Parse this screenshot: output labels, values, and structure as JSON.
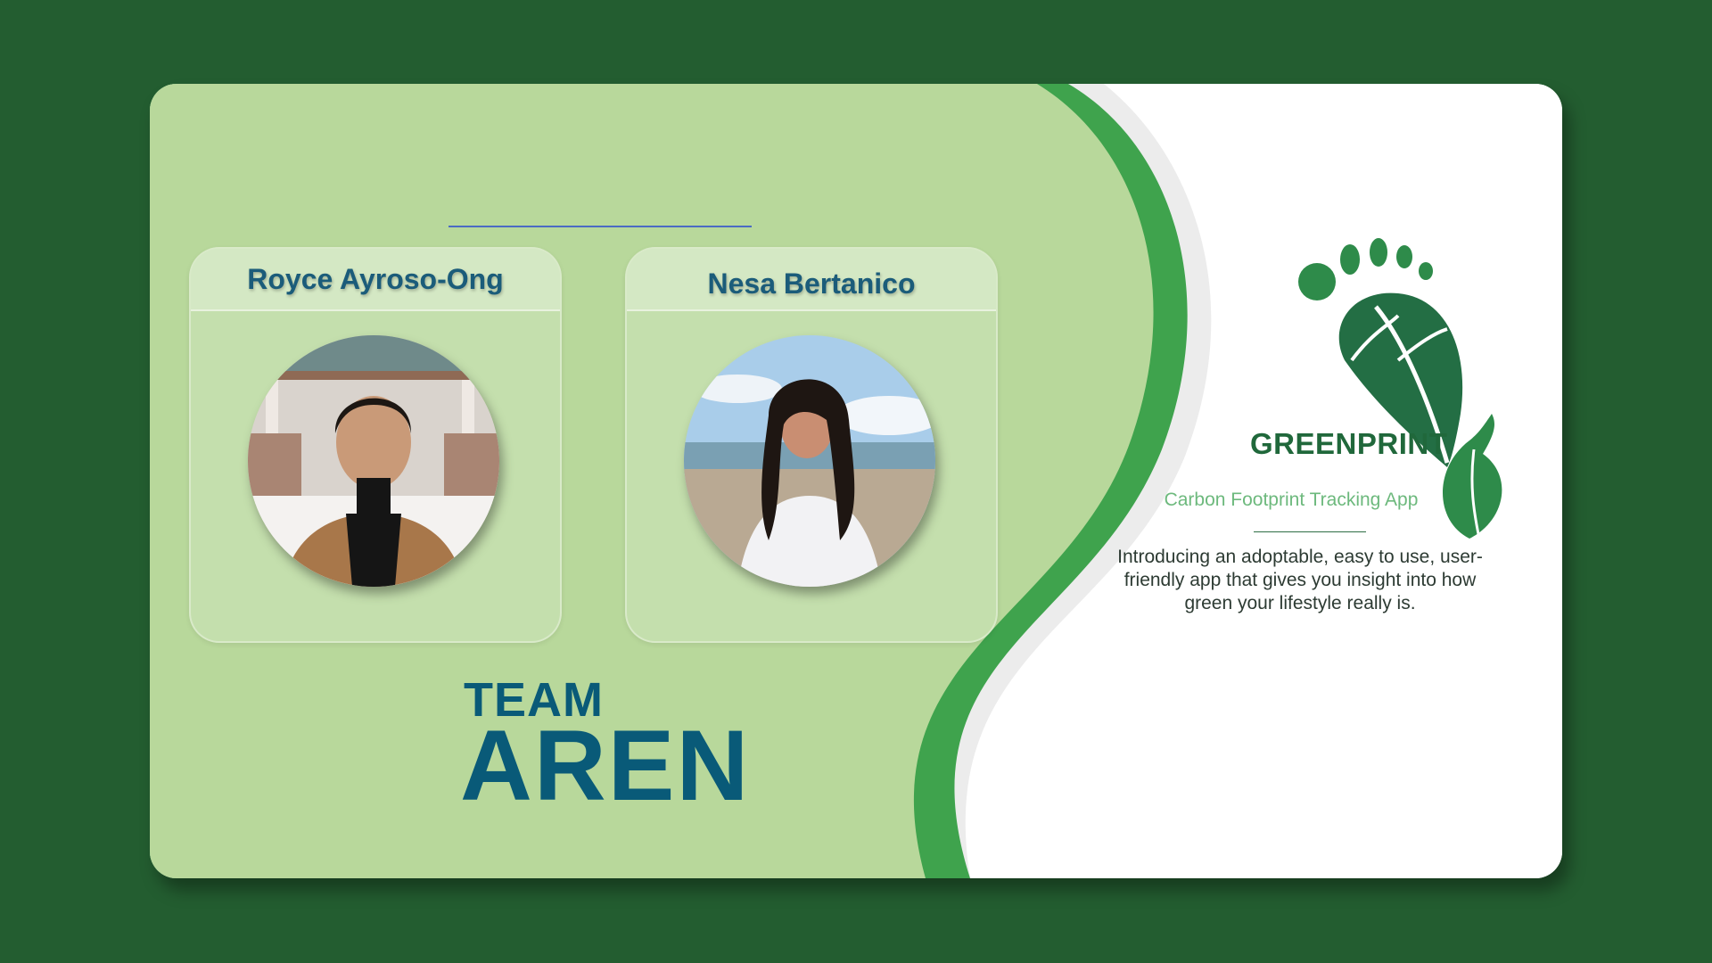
{
  "team": {
    "label_small": "TEAM",
    "label_big": "AREN"
  },
  "members": [
    {
      "name": "Royce Ayroso-Ong"
    },
    {
      "name": "Nesa Bertanico"
    }
  ],
  "app": {
    "name": "GREENPRINT",
    "tagline": "Carbon Footprint Tracking App",
    "description": "Introducing an adoptable, easy to use, user-friendly app that gives you insight into how green your lifestyle really is."
  },
  "colors": {
    "background": "#235d30",
    "panel": "#b8d89b",
    "accent_green": "#3fa34d",
    "title_blue": "#095a78"
  },
  "icons": [
    "footprint-leaf-logo-icon"
  ]
}
